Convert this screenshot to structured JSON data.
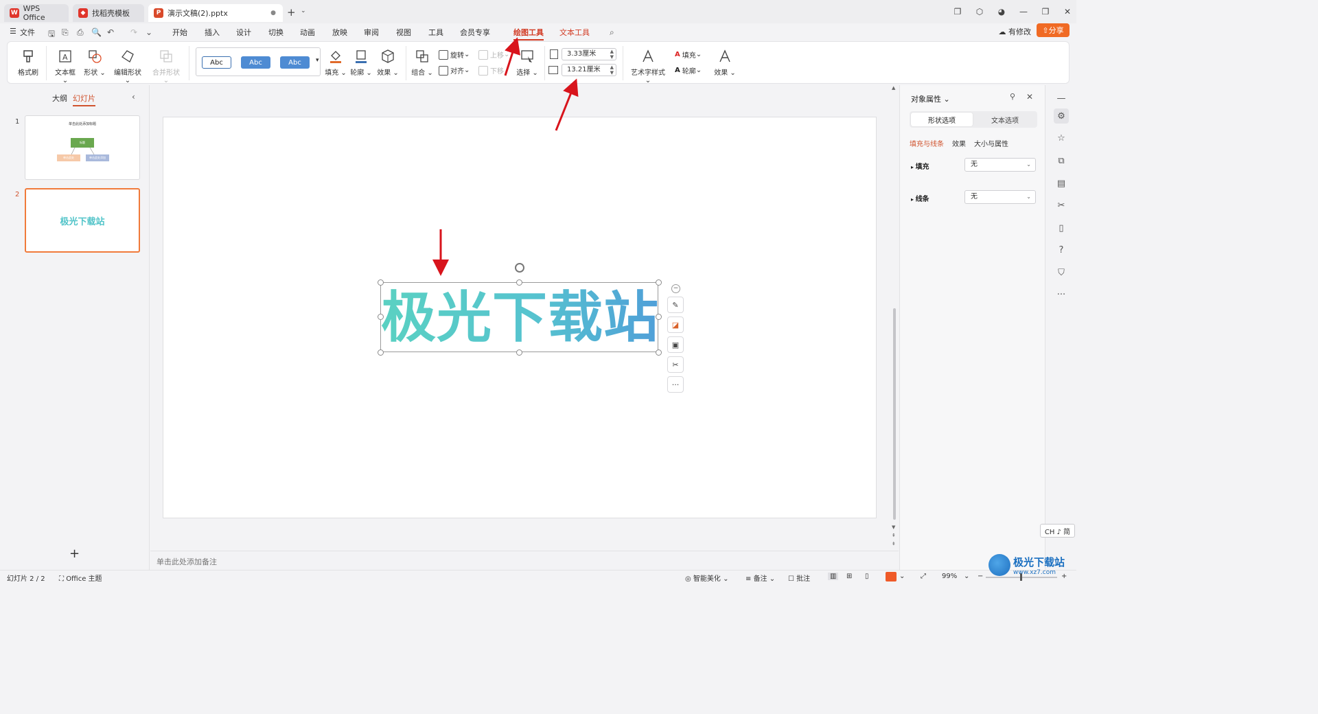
{
  "titlebar": {
    "tabs": [
      {
        "label": "WPS Office"
      },
      {
        "label": "找稻壳模板"
      },
      {
        "label": "演示文稿(2).pptx"
      }
    ],
    "new_tab": "+"
  },
  "menubar": {
    "file": "文件",
    "items": [
      "开始",
      "插入",
      "设计",
      "切换",
      "动画",
      "放映",
      "审阅",
      "视图",
      "工具",
      "会员专享",
      "绘图工具",
      "文本工具"
    ],
    "active": "绘图工具",
    "modify_label": "有修改",
    "share_label": "分享"
  },
  "ribbon": {
    "format_painter": "格式刷",
    "textbox": "文本框",
    "shape": "形状",
    "edit_shape": "编辑形状",
    "merge_shape": "合并形状",
    "style_samples": [
      "Abc",
      "Abc",
      "Abc"
    ],
    "fill": "填充",
    "outline": "轮廓",
    "effect": "效果",
    "group": "组合",
    "rotate": "旋转",
    "align": "对齐",
    "move_up": "上移",
    "move_down": "下移",
    "select": "选择",
    "height_value": "3.33厘米",
    "width_value": "13.21厘米",
    "art_style": "艺术字样式",
    "text_fill": "填充",
    "text_outline": "轮廓",
    "text_effect": "效果"
  },
  "left_panel": {
    "tab_outline": "大纲",
    "tab_slides": "幻灯片",
    "slides": [
      {
        "number": "1",
        "title": "单击此处添加标题",
        "box_center": "标题",
        "box_left": "单击此处",
        "box_right": "单击此处添加"
      },
      {
        "number": "2",
        "title": "极光下载站"
      }
    ]
  },
  "slide": {
    "text": "极光下载站"
  },
  "notes": {
    "placeholder": "单击此处添加备注"
  },
  "right_panel": {
    "title": "对象属性",
    "seg_shape": "形状选项",
    "seg_text": "文本选项",
    "sub_fill_line": "填充与线条",
    "sub_effect": "效果",
    "sub_size": "大小与属性",
    "fill_label": "填充",
    "fill_value": "无",
    "line_label": "线条",
    "line_value": "无"
  },
  "ime": "CH ♪ 简",
  "statusbar": {
    "slide_count": "幻灯片 2 / 2",
    "theme": "Office 主题",
    "smart": "智能美化",
    "notes": "备注",
    "comments": "批注",
    "zoom": "99%"
  },
  "watermark": {
    "title": "极光下载站",
    "url": "www.xz7.com"
  },
  "colors": {
    "accent": "#d23b24",
    "share": "#f06a24",
    "text_gradient_start": "#5ad1c2",
    "text_gradient_end": "#4f9fd8",
    "arrow": "#d8141c"
  }
}
